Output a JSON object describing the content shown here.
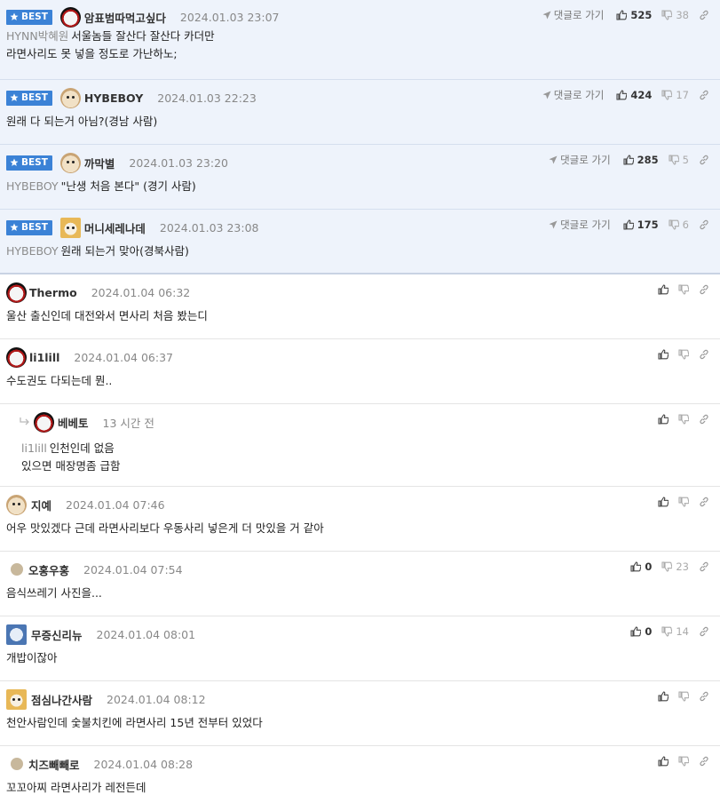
{
  "labels": {
    "best": "BEST",
    "goto": "댓글로 가기"
  },
  "best": [
    {
      "nick": "암표범따먹고싶다",
      "date": "2024.01.03 23:07",
      "mention": "HYNN박혜원",
      "lines": [
        "서울놈들 잘산다 잘산다 카더만",
        "라면사리도 못 넣을 정도로 가난하노;"
      ],
      "likes": "525",
      "dislikes": "38",
      "avatar": "bw"
    },
    {
      "nick": "HYBEBOY",
      "date": "2024.01.03 22:23",
      "mention": "",
      "lines": [
        "원래 다 되는거 아님?(경남 사람)"
      ],
      "likes": "424",
      "dislikes": "17",
      "avatar": "dog"
    },
    {
      "nick": "까막별",
      "date": "2024.01.03 23:20",
      "mention": "HYBEBOY",
      "lines": [
        "\"난생 처음 본다\" (경기 사람)"
      ],
      "likes": "285",
      "dislikes": "5",
      "avatar": "dog"
    },
    {
      "nick": "머니세레나데",
      "date": "2024.01.03 23:08",
      "mention": "HYBEBOY",
      "lines": [
        "원래 되는거 맞아(경북사람)"
      ],
      "likes": "175",
      "dislikes": "6",
      "avatar": "fox"
    }
  ],
  "comments": [
    {
      "nick": "Thermo",
      "date": "2024.01.04 06:32",
      "text": "울산 출신인데 대전와서 면사리 처음 봤는디",
      "likes": "",
      "dislikes": "",
      "avatar": "bw"
    },
    {
      "nick": "li1lill",
      "date": "2024.01.04 06:37",
      "text": "수도권도 다되는데 뭔..",
      "likes": "",
      "dislikes": "",
      "avatar": "bw"
    },
    {
      "nick": "베베토",
      "date": "13 시간 전",
      "mention": "li1lill",
      "lines": [
        "인천인데 없음",
        "있으면 매장명좀 급함"
      ],
      "reply": true,
      "avatar": "bw"
    },
    {
      "nick": "지예",
      "date": "2024.01.04 07:46",
      "text": "어우 맛있겠다 근데 라면사리보다 우동사리 넣은게 더 맛있을 거 같아",
      "likes": "",
      "dislikes": "",
      "avatar": "dog"
    },
    {
      "nick": "오홍우홍",
      "date": "2024.01.04 07:54",
      "text": "음식쓰레기 사진을...",
      "likes": "0",
      "dislikes": "23",
      "avatar": "dot"
    },
    {
      "nick": "무증신리뉴",
      "date": "2024.01.04 08:01",
      "text": "개밥이잖아",
      "likes": "0",
      "dislikes": "14",
      "avatar": "blue"
    },
    {
      "nick": "점심나간사람",
      "date": "2024.01.04 08:12",
      "text": "천안사람인데 숯불치킨에 라면사리 15년 전부터 있었다",
      "likes": "",
      "dislikes": "",
      "avatar": "fox"
    },
    {
      "nick": "치즈빼빼로",
      "date": "2024.01.04 08:28",
      "text": "꼬꼬아찌 라면사리가 레전든데",
      "likes": "",
      "dislikes": "",
      "avatar": "dot"
    }
  ],
  "colors": {
    "best_bg": "#eef3fb",
    "badge": "#3b82d6",
    "mention": "#8c8c8c"
  },
  "icons": {
    "star": "star-icon",
    "send": "send-arrow-icon",
    "like": "thumbs-up-icon",
    "dislike": "thumbs-down-icon",
    "link": "link-icon",
    "reply": "reply-arrow-icon"
  }
}
